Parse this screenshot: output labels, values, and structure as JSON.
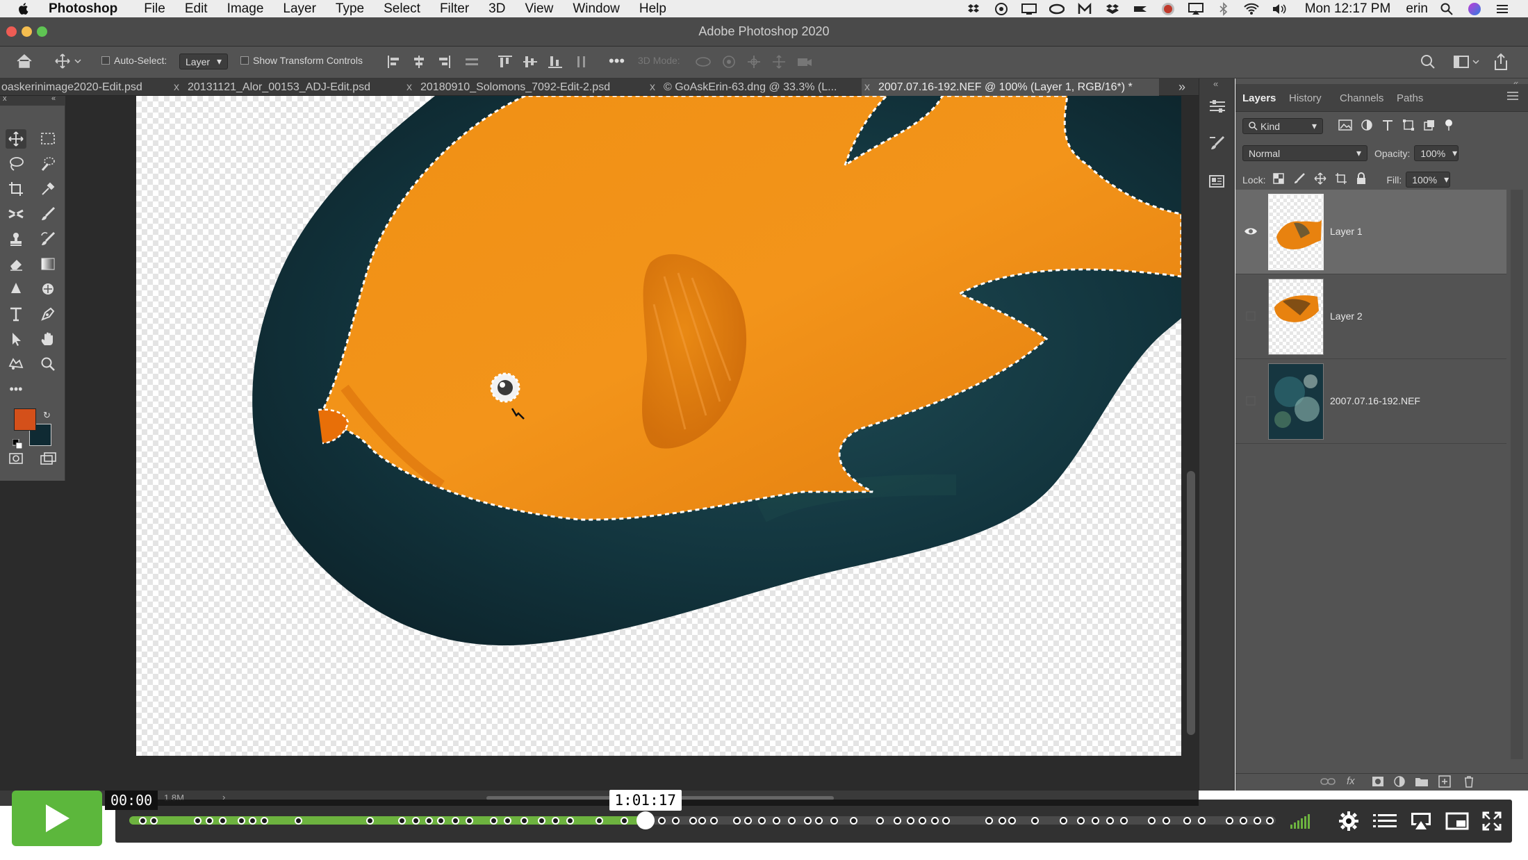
{
  "menubar": {
    "app_name": "Photoshop",
    "items": [
      "File",
      "Edit",
      "Image",
      "Layer",
      "Type",
      "Select",
      "Filter",
      "3D",
      "View",
      "Window",
      "Help"
    ],
    "clock": "Mon 12:17 PM",
    "user": "erin",
    "status_icons": [
      "dropbox-icon",
      "privacy-icon",
      "display-icon",
      "creative-cloud-icon",
      "m-icon",
      "dropbox-box-icon",
      "bolt-icon",
      "record-icon",
      "airplay-icon",
      "bluetooth-icon",
      "wifi-icon",
      "volume-icon",
      "spotlight-icon",
      "siri-icon",
      "list-icon"
    ]
  },
  "window": {
    "title": "Adobe Photoshop 2020"
  },
  "options_bar": {
    "auto_select_label": "Auto-Select:",
    "auto_select_value": "Layer",
    "show_transform_label": "Show Transform Controls",
    "three_d_mode_label": "3D Mode:"
  },
  "document_tabs": [
    {
      "label": "oaskerinimage2020-Edit.psd",
      "active": false
    },
    {
      "label": "20131121_Alor_00153_ADJ-Edit.psd",
      "active": false
    },
    {
      "label": "20180910_Solomons_7092-Edit-2.psd",
      "active": false
    },
    {
      "label": "© GoAskErin-63.dng @ 33.3% (L...",
      "active": false
    },
    {
      "label": "2007.07.16-192.NEF @ 100% (Layer 1, RGB/16*) *",
      "active": true
    }
  ],
  "tools": {
    "foreground_color": "#d4501a",
    "background_color": "#0f2a33"
  },
  "layers_panel": {
    "tabs": [
      "Layers",
      "History",
      "Channels",
      "Paths"
    ],
    "active_tab": "Layers",
    "filter_kind": "Kind",
    "blend_mode": "Normal",
    "opacity_label": "Opacity:",
    "opacity_value": "100%",
    "lock_label": "Lock:",
    "fill_label": "Fill:",
    "fill_value": "100%",
    "layers": [
      {
        "name": "Layer 1",
        "visible": true,
        "selected": true
      },
      {
        "name": "Layer 2",
        "visible": false,
        "selected": false
      },
      {
        "name": "2007.07.16-192.NEF",
        "visible": false,
        "selected": false
      }
    ]
  },
  "status_bar": {
    "doc_info": "1.8M"
  },
  "player": {
    "current_time": "00:00",
    "hover_time": "1:01:17",
    "played_fraction": 0.45,
    "accent_color": "#5cb73c"
  }
}
